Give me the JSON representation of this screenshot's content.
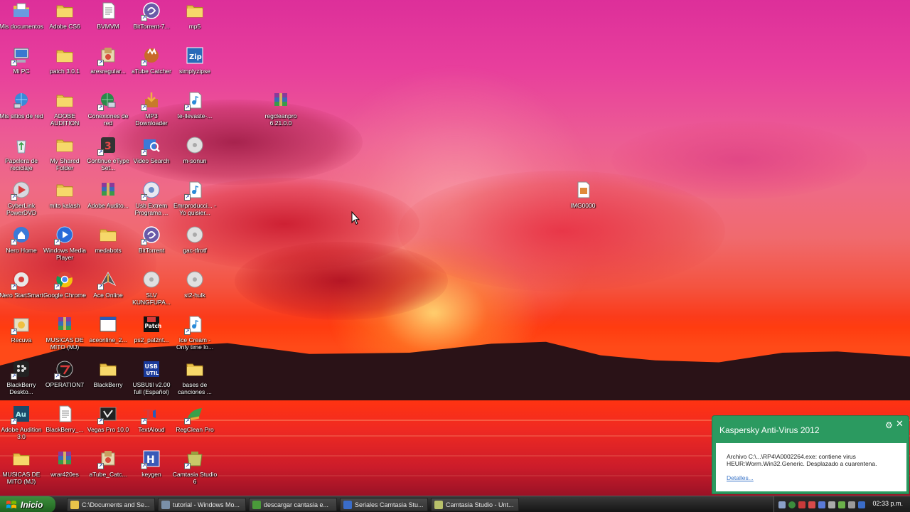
{
  "desktop": {
    "icons": [
      {
        "label": "Mis documentos",
        "icon": "my-documents-icon"
      },
      {
        "label": "Adobe CS6",
        "icon": "folder-icon"
      },
      {
        "label": "BVMVM",
        "icon": "text-file-icon"
      },
      {
        "label": "BitTorrent-7...",
        "icon": "bittorrent-icon"
      },
      {
        "label": "mp5",
        "icon": "folder-icon"
      },
      {
        "label": "Mi PC",
        "icon": "my-computer-icon"
      },
      {
        "label": "patch 3.0.1",
        "icon": "folder-icon"
      },
      {
        "label": "aresregular...",
        "icon": "installer-icon"
      },
      {
        "label": "aTube Catcher",
        "icon": "atube-catcher-icon"
      },
      {
        "label": "simplyzipse",
        "icon": "zip-icon"
      },
      {
        "label": "Mis sitios de red",
        "icon": "network-places-icon"
      },
      {
        "label": "ADOBE AUDITION",
        "icon": "folder-icon"
      },
      {
        "label": "Conexiones de red",
        "icon": "network-connections-icon"
      },
      {
        "label": "MP3 Downloader",
        "icon": "mp3-downloader-icon"
      },
      {
        "label": "te-llevaste-...",
        "icon": "mp3-file-icon"
      },
      {
        "label": "regcleanpro 6.21.0.0",
        "icon": "winrar-icon"
      },
      {
        "label": "Papelera de reciclaje",
        "icon": "recycle-bin-icon"
      },
      {
        "label": "My Shared Folder",
        "icon": "folder-icon"
      },
      {
        "label": "Continue eType Set...",
        "icon": "etype-icon"
      },
      {
        "label": "Video Search",
        "icon": "video-search-icon"
      },
      {
        "label": "m-sonun",
        "icon": "disc-image-icon"
      },
      {
        "label": "CyberLink PowerDVD",
        "icon": "powerdvd-icon"
      },
      {
        "label": "mito kalash",
        "icon": "folder-icon"
      },
      {
        "label": "Adobe Audito...",
        "icon": "winrar-icon"
      },
      {
        "label": "Usb Extrem Programa ...",
        "icon": "usb-program-icon"
      },
      {
        "label": "Emrproducci... - Yo quisier...",
        "icon": "mp3-file-icon"
      },
      {
        "label": "IMG0000",
        "icon": "image-file-icon"
      },
      {
        "label": "Nero Home",
        "icon": "nero-home-icon"
      },
      {
        "label": "Windows Media Player",
        "icon": "media-player-icon"
      },
      {
        "label": "medabots",
        "icon": "folder-icon"
      },
      {
        "label": "BitTorrent",
        "icon": "bittorrent-icon"
      },
      {
        "label": "gac-tfrotf",
        "icon": "disc-image-icon"
      },
      {
        "label": "Nero StartSmart",
        "icon": "nero-startsmart-icon"
      },
      {
        "label": "Google Chrome",
        "icon": "chrome-icon"
      },
      {
        "label": "Ace Online",
        "icon": "ace-online-icon"
      },
      {
        "label": "SLV KUNGFUPA...",
        "icon": "disc-image-icon"
      },
      {
        "label": "st2-hulk",
        "icon": "disc-image-icon"
      },
      {
        "label": "Recuva",
        "icon": "recuva-icon"
      },
      {
        "label": "MUSICAS DE MITO (MJ)",
        "icon": "winrar-icon"
      },
      {
        "label": "aceonline_2...",
        "icon": "window-app-icon"
      },
      {
        "label": "ps2_pal2nt...",
        "icon": "patch-icon"
      },
      {
        "label": "Ice Cream - Only time lo...",
        "icon": "mp3-file-icon"
      },
      {
        "label": "BlackBerry Deskto...",
        "icon": "blackberry-icon"
      },
      {
        "label": "OPERATION7",
        "icon": "operation7-icon"
      },
      {
        "label": "BlackBerry",
        "icon": "folder-icon"
      },
      {
        "label": "USBUtil v2.00 full (Español)",
        "icon": "usbutil-icon"
      },
      {
        "label": "bases de canciones ...",
        "icon": "folder-icon"
      },
      {
        "label": "Adobe Audition 3.0",
        "icon": "audition-icon"
      },
      {
        "label": "BlackBerry_...",
        "icon": "text-file-icon"
      },
      {
        "label": "Vegas Pro 10.0",
        "icon": "vegas-icon"
      },
      {
        "label": "TextAloud",
        "icon": "textaloud-icon"
      },
      {
        "label": "RegClean Pro",
        "icon": "regclean-icon"
      },
      {
        "label": "MUSICAS DE MITO (MJ)",
        "icon": "folder-icon"
      },
      {
        "label": "wrar420es",
        "icon": "winrar-installer-icon"
      },
      {
        "label": "aTube_Catc...",
        "icon": "installer-icon"
      },
      {
        "label": "keygen",
        "icon": "keygen-icon"
      },
      {
        "label": "Camtasia Studio 6",
        "icon": "camtasia-icon"
      }
    ]
  },
  "notification": {
    "title": "Kaspersky Anti-Virus 2012",
    "message": "Archivo C:\\...\\RP4\\A0002264.exe: contiene virus HEUR:Worm.Win32.Generic. Desplazado a cuarentena.",
    "link": "Detalles..."
  },
  "taskbar": {
    "start_label": "Inicio",
    "tasks": [
      {
        "label": "C:\\Documents and Se...",
        "icon": "folder-icon",
        "color": "#e8c34a"
      },
      {
        "label": "tutorial - Windows Mo...",
        "icon": "movie-maker-icon",
        "color": "#7a8fa8"
      },
      {
        "label": "descargar cantasia e...",
        "icon": "chrome-icon",
        "color": "#4a9a3a"
      },
      {
        "label": "Seriales Camtasia Stu...",
        "icon": "document-icon",
        "color": "#3a6cc8"
      },
      {
        "label": "Camtasia Studio - Unt...",
        "icon": "camtasia-icon",
        "color": "#b8c06a"
      }
    ],
    "clock": "02:33 p.m."
  }
}
